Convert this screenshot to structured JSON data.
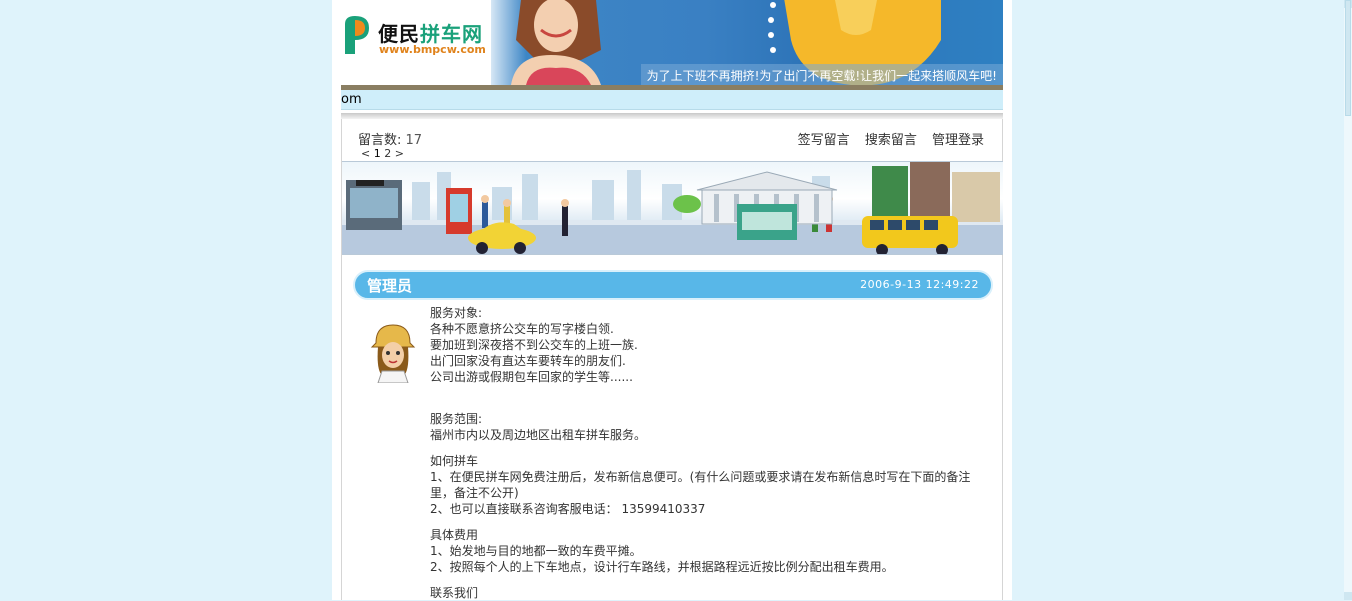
{
  "header": {
    "logo_name_part1": "便民",
    "logo_name_part2": "拼车网",
    "logo_url": "www.bmpcw.com",
    "slogan": "为了上下班不再拥挤!为了出门不再空载!让我们一起来搭顺风车吧!",
    "nav_fragment": "om"
  },
  "guestbook": {
    "count_label": "留言数:",
    "count_value": "17",
    "links": [
      "签写留言",
      "搜索留言",
      "管理登录"
    ],
    "pager": {
      "prev": "<",
      "pages": [
        "1",
        "2"
      ],
      "next": ">"
    }
  },
  "post": {
    "author": "管理员",
    "time": "2006-9-13 12:49:22",
    "lines": {
      "l1": "服务对象:",
      "l2": "各种不愿意挤公交车的写字楼白领.",
      "l3": "要加班到深夜搭不到公交车的上班一族.",
      "l4": "出门回家没有直达车要转车的朋友们.",
      "l5": "公司出游或假期包车回家的学生等......",
      "l6": "服务范围:",
      "l7": "福州市内以及周边地区出租车拼车服务。",
      "l8": "如何拼车",
      "l9": "1、在便民拼车网免费注册后，发布新信息便可。(有什么问题或要求请在发布新信息时写在下面的备注里，备注不公开)",
      "l10": "2、也可以直接联系咨询客服电话： 13599410337",
      "l11": "具体费用",
      "l12": "1、始发地与目的地都一致的车费平摊。",
      "l13": "2、按照每个人的上下车地点，设计行车路线，并根据路程远近按比例分配出租车费用。",
      "l14": "联系我们"
    }
  },
  "colors": {
    "page_bg": "#dff3fb",
    "post_header": "#58b7e8",
    "logo_green": "#1aa17a",
    "logo_orange": "#e0831c"
  }
}
